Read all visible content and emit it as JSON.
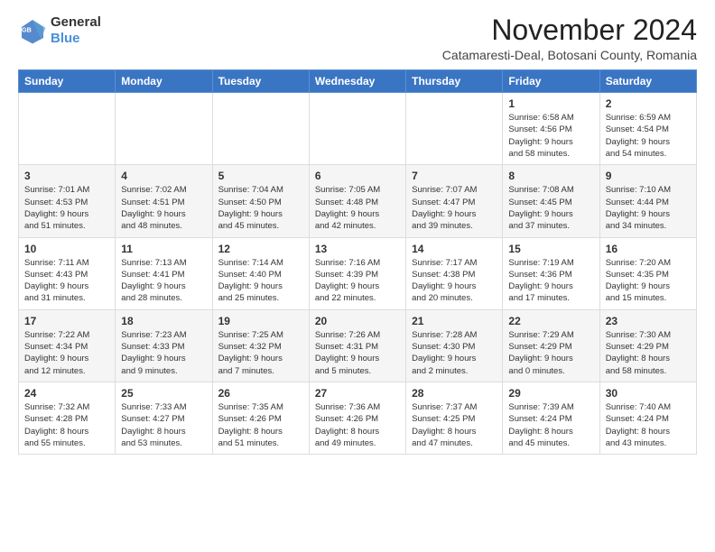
{
  "logo": {
    "line1": "General",
    "line2": "Blue"
  },
  "title": "November 2024",
  "subtitle": "Catamaresti-Deal, Botosani County, Romania",
  "days_of_week": [
    "Sunday",
    "Monday",
    "Tuesday",
    "Wednesday",
    "Thursday",
    "Friday",
    "Saturday"
  ],
  "weeks": [
    [
      {
        "num": "",
        "info": ""
      },
      {
        "num": "",
        "info": ""
      },
      {
        "num": "",
        "info": ""
      },
      {
        "num": "",
        "info": ""
      },
      {
        "num": "",
        "info": ""
      },
      {
        "num": "1",
        "info": "Sunrise: 6:58 AM\nSunset: 4:56 PM\nDaylight: 9 hours\nand 58 minutes."
      },
      {
        "num": "2",
        "info": "Sunrise: 6:59 AM\nSunset: 4:54 PM\nDaylight: 9 hours\nand 54 minutes."
      }
    ],
    [
      {
        "num": "3",
        "info": "Sunrise: 7:01 AM\nSunset: 4:53 PM\nDaylight: 9 hours\nand 51 minutes."
      },
      {
        "num": "4",
        "info": "Sunrise: 7:02 AM\nSunset: 4:51 PM\nDaylight: 9 hours\nand 48 minutes."
      },
      {
        "num": "5",
        "info": "Sunrise: 7:04 AM\nSunset: 4:50 PM\nDaylight: 9 hours\nand 45 minutes."
      },
      {
        "num": "6",
        "info": "Sunrise: 7:05 AM\nSunset: 4:48 PM\nDaylight: 9 hours\nand 42 minutes."
      },
      {
        "num": "7",
        "info": "Sunrise: 7:07 AM\nSunset: 4:47 PM\nDaylight: 9 hours\nand 39 minutes."
      },
      {
        "num": "8",
        "info": "Sunrise: 7:08 AM\nSunset: 4:45 PM\nDaylight: 9 hours\nand 37 minutes."
      },
      {
        "num": "9",
        "info": "Sunrise: 7:10 AM\nSunset: 4:44 PM\nDaylight: 9 hours\nand 34 minutes."
      }
    ],
    [
      {
        "num": "10",
        "info": "Sunrise: 7:11 AM\nSunset: 4:43 PM\nDaylight: 9 hours\nand 31 minutes."
      },
      {
        "num": "11",
        "info": "Sunrise: 7:13 AM\nSunset: 4:41 PM\nDaylight: 9 hours\nand 28 minutes."
      },
      {
        "num": "12",
        "info": "Sunrise: 7:14 AM\nSunset: 4:40 PM\nDaylight: 9 hours\nand 25 minutes."
      },
      {
        "num": "13",
        "info": "Sunrise: 7:16 AM\nSunset: 4:39 PM\nDaylight: 9 hours\nand 22 minutes."
      },
      {
        "num": "14",
        "info": "Sunrise: 7:17 AM\nSunset: 4:38 PM\nDaylight: 9 hours\nand 20 minutes."
      },
      {
        "num": "15",
        "info": "Sunrise: 7:19 AM\nSunset: 4:36 PM\nDaylight: 9 hours\nand 17 minutes."
      },
      {
        "num": "16",
        "info": "Sunrise: 7:20 AM\nSunset: 4:35 PM\nDaylight: 9 hours\nand 15 minutes."
      }
    ],
    [
      {
        "num": "17",
        "info": "Sunrise: 7:22 AM\nSunset: 4:34 PM\nDaylight: 9 hours\nand 12 minutes."
      },
      {
        "num": "18",
        "info": "Sunrise: 7:23 AM\nSunset: 4:33 PM\nDaylight: 9 hours\nand 9 minutes."
      },
      {
        "num": "19",
        "info": "Sunrise: 7:25 AM\nSunset: 4:32 PM\nDaylight: 9 hours\nand 7 minutes."
      },
      {
        "num": "20",
        "info": "Sunrise: 7:26 AM\nSunset: 4:31 PM\nDaylight: 9 hours\nand 5 minutes."
      },
      {
        "num": "21",
        "info": "Sunrise: 7:28 AM\nSunset: 4:30 PM\nDaylight: 9 hours\nand 2 minutes."
      },
      {
        "num": "22",
        "info": "Sunrise: 7:29 AM\nSunset: 4:29 PM\nDaylight: 9 hours\nand 0 minutes."
      },
      {
        "num": "23",
        "info": "Sunrise: 7:30 AM\nSunset: 4:29 PM\nDaylight: 8 hours\nand 58 minutes."
      }
    ],
    [
      {
        "num": "24",
        "info": "Sunrise: 7:32 AM\nSunset: 4:28 PM\nDaylight: 8 hours\nand 55 minutes."
      },
      {
        "num": "25",
        "info": "Sunrise: 7:33 AM\nSunset: 4:27 PM\nDaylight: 8 hours\nand 53 minutes."
      },
      {
        "num": "26",
        "info": "Sunrise: 7:35 AM\nSunset: 4:26 PM\nDaylight: 8 hours\nand 51 minutes."
      },
      {
        "num": "27",
        "info": "Sunrise: 7:36 AM\nSunset: 4:26 PM\nDaylight: 8 hours\nand 49 minutes."
      },
      {
        "num": "28",
        "info": "Sunrise: 7:37 AM\nSunset: 4:25 PM\nDaylight: 8 hours\nand 47 minutes."
      },
      {
        "num": "29",
        "info": "Sunrise: 7:39 AM\nSunset: 4:24 PM\nDaylight: 8 hours\nand 45 minutes."
      },
      {
        "num": "30",
        "info": "Sunrise: 7:40 AM\nSunset: 4:24 PM\nDaylight: 8 hours\nand 43 minutes."
      }
    ]
  ]
}
